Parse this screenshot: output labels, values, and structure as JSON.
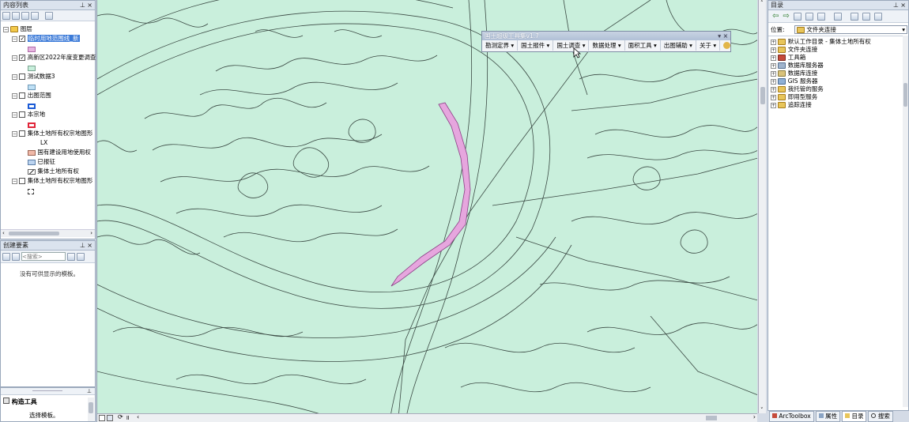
{
  "toc": {
    "title": "内容列表",
    "pin": "ᵖ",
    "close": "×",
    "root": "图层",
    "layers": [
      {
        "name": "临时用地范围线_新",
        "checked": true,
        "selected": true,
        "sym_color": "#e7b6e0",
        "sym_border": "#b06aa8"
      },
      {
        "name": "高新区2022年度变更调查",
        "checked": true,
        "sym_color": "#c8efdc",
        "sym_border": "#7aa390"
      },
      {
        "name": "测试数据3",
        "checked": false,
        "sym_color": "#bfe0f5",
        "sym_border": "#6f9ab8"
      },
      {
        "name": "出图范围",
        "checked": false,
        "sym_color": "#ffffff",
        "sym_border": "#1b5bd6"
      },
      {
        "name": "本宗地",
        "checked": false,
        "sym_color": "#ffffff",
        "sym_border": "#e0263a"
      }
    ],
    "group_layer": {
      "name": "集体土地所有权宗地图形",
      "checked": false,
      "field": "LX",
      "classes": [
        {
          "label": "国有建设用地使用权",
          "color": "#f0b9a8"
        },
        {
          "label": "已报征",
          "color": "#bcd4f0"
        },
        {
          "label": "集体土地所有权",
          "color": "#ffffff"
        }
      ]
    },
    "last_layer": {
      "name": "集体土地所有权宗地图形",
      "checked": false
    }
  },
  "create": {
    "title": "创建要素",
    "search_placeholder": "<搜索>",
    "empty_msg": "没有可供显示的模板。"
  },
  "construct": {
    "title": "构造工具",
    "hint": "选择模板。"
  },
  "catalog": {
    "title": "目录",
    "location_label": "位置:",
    "location_value": "文件夹连接",
    "items": [
      "默认工作目录 - 集体土地所有权",
      "文件夹连接",
      "工具箱",
      "数据库服务器",
      "数据库连接",
      "GIS 服务器",
      "我托管的服务",
      "即用型服务",
      "追踪连接"
    ]
  },
  "toolbar": {
    "title": "国土超级工具集v1.7",
    "menus": [
      "勘测定界",
      "国土报件",
      "国土调查",
      "数据处理",
      "面积工具",
      "出图辅助",
      "关于"
    ]
  },
  "bottom_tabs": [
    "ArcToolbox",
    "属性",
    "目录",
    "搜索"
  ],
  "colors": {
    "map_bg": "#c9efdc",
    "line": "#3b4a44",
    "accent": "#e6a6de",
    "highlight": "#3b7ad8"
  }
}
